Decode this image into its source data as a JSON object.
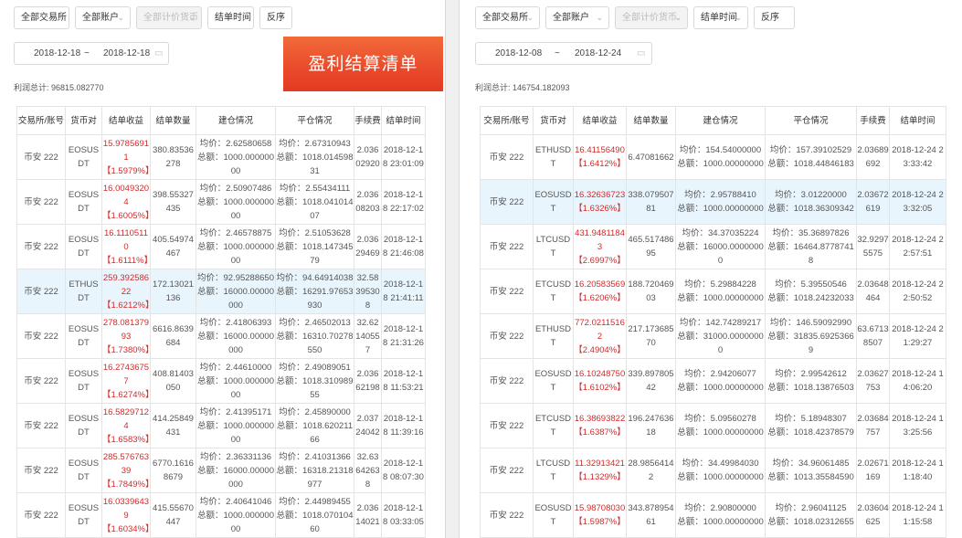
{
  "left": {
    "filters": [
      "全部交易所",
      "全部账户",
      "全部计价货币",
      "结单时间",
      "反序"
    ],
    "date_start": "2018-12-18",
    "date_sep": "~",
    "date_end": "2018-12-18",
    "total": "利润总计: 96815.082770",
    "headers": [
      "交易所/账号",
      "货币对",
      "结单收益",
      "结单数量",
      "建仓情况",
      "平仓情况",
      "手续费",
      "结单时间"
    ],
    "rows": [
      {
        "exchange": "币安 222",
        "pair": "EOSUSDT",
        "profit": "15.97856911",
        "pct": "【1.5979%】",
        "qty": "380.83536278",
        "open_price": "均价：2.62580658",
        "open_total": "总额：1000.00000000",
        "close_price": "均价：2.67310943",
        "close_total": "总额：1018.01459831",
        "fee": "2.03602920",
        "time": "2018-12-18 23:01:09",
        "highlight": false
      },
      {
        "exchange": "币安 222",
        "pair": "EOSUSDT",
        "profit": "16.00493204",
        "pct": "【1.6005%】",
        "qty": "398.55327435",
        "open_price": "均价：2.50907486",
        "open_total": "总额：1000.00000000",
        "close_price": "均价：2.55434111",
        "close_total": "总额：1018.04101407",
        "fee": "2.03608203",
        "time": "2018-12-18 22:17:02",
        "highlight": false
      },
      {
        "exchange": "币安 222",
        "pair": "EOSUSDT",
        "profit": "16.11105110",
        "pct": "【1.6111%】",
        "qty": "405.54974467",
        "open_price": "均价：2.46578875",
        "open_total": "总额：1000.00000000",
        "close_price": "均价：2.51053628",
        "close_total": "总额：1018.14734579",
        "fee": "2.03629469",
        "time": "2018-12-18 21:46:08",
        "highlight": false
      },
      {
        "exchange": "币安 222",
        "pair": "ETHUSDT",
        "profit": "259.39258622",
        "pct": "【1.6212%】",
        "qty": "172.13021136",
        "open_price": "均价：92.95288650",
        "open_total": "总额：16000.00000000",
        "close_price": "均价：94.64914038",
        "close_total": "总额：16291.97653930",
        "fee": "32.58395308",
        "time": "2018-12-18 21:41:11",
        "highlight": true
      },
      {
        "exchange": "币安 222",
        "pair": "EOSUSDT",
        "profit": "278.08137993",
        "pct": "【1.7380%】",
        "qty": "6616.8639684",
        "open_price": "均价：2.41806393",
        "open_total": "总额：16000.00000000",
        "close_price": "均价：2.46502013",
        "close_total": "总额：16310.70278550",
        "fee": "32.62140557",
        "time": "2018-12-18 21:31:26",
        "highlight": false
      },
      {
        "exchange": "币安 222",
        "pair": "EOSUSDT",
        "profit": "16.27436757",
        "pct": "【1.6274%】",
        "qty": "408.81403050",
        "open_price": "均价：2.44610000",
        "open_total": "总额：1000.00000000",
        "close_price": "均价：2.49089051",
        "close_total": "总额：1018.31098955",
        "fee": "2.03662198",
        "time": "2018-12-18 11:53:21",
        "highlight": false
      },
      {
        "exchange": "币安 222",
        "pair": "EOSUSDT",
        "profit": "16.58297124",
        "pct": "【1.6583%】",
        "qty": "414.25849431",
        "open_price": "均价：2.41395171",
        "open_total": "总额：1000.00000000",
        "close_price": "均价：2.45890000",
        "close_total": "总额：1018.62021166",
        "fee": "2.03724042",
        "time": "2018-12-18 11:39:16",
        "highlight": false
      },
      {
        "exchange": "币安 222",
        "pair": "EOSUSDT",
        "profit": "285.57676339",
        "pct": "【1.7849%】",
        "qty": "6770.16168679",
        "open_price": "均价：2.36331136",
        "open_total": "总额：16000.00000000",
        "close_price": "均价：2.41031366",
        "close_total": "总额：16318.21318977",
        "fee": "32.63642638",
        "time": "2018-12-18 08:07:30",
        "highlight": false
      },
      {
        "exchange": "币安 222",
        "pair": "EOSUSDT",
        "profit": "16.03396439",
        "pct": "【1.6034%】",
        "qty": "415.55670447",
        "open_price": "均价：2.40641046",
        "open_total": "总额：1000.00000000",
        "close_price": "均价：2.44989455",
        "close_total": "总额：1018.07010460",
        "fee": "2.03614021",
        "time": "2018-12-18 03:33:05",
        "highlight": false
      }
    ]
  },
  "right": {
    "filters": [
      "全部交易所",
      "全部账户",
      "全部计价货币",
      "结单时间",
      "反序"
    ],
    "date_start": "2018-12-08",
    "date_sep": "~",
    "date_end": "2018-12-24",
    "total": "利润总计: 146754.182093",
    "headers": [
      "交易所/账号",
      "货币对",
      "结单收益",
      "结单数量",
      "建仓情况",
      "平仓情况",
      "手续费",
      "结单时间"
    ],
    "rows": [
      {
        "exchange": "币安 222",
        "pair": "ETHUSDT",
        "profit": "16.41156490",
        "pct": "【1.6412%】",
        "qty": "6.47081662",
        "open_price": "均价：154.54000000",
        "open_total": "总额：1000.00000000",
        "close_price": "均价：157.39102529",
        "close_total": "总额：1018.44846183",
        "fee": "2.03689692",
        "time": "2018-12-24 23:33:42",
        "highlight": false
      },
      {
        "exchange": "币安 222",
        "pair": "EOSUSDT",
        "profit": "16.32636723",
        "pct": "【1.6326%】",
        "qty": "338.07950781",
        "open_price": "均价：2.95788410",
        "open_total": "总额：1000.00000000",
        "close_price": "均价：3.01220000",
        "close_total": "总额：1018.36309342",
        "fee": "2.03672619",
        "time": "2018-12-24 23:32:05",
        "highlight": true
      },
      {
        "exchange": "币安 222",
        "pair": "LTCUSDT",
        "profit": "431.94811843",
        "pct": "【2.6997%】",
        "qty": "465.51748695",
        "open_price": "均价：34.37035224",
        "open_total": "总额：16000.00000000",
        "close_price": "均价：35.36897826",
        "close_total": "总额：16464.87787418",
        "fee": "32.92975575",
        "time": "2018-12-24 22:57:51",
        "highlight": false
      },
      {
        "exchange": "币安 222",
        "pair": "ETCUSDT",
        "profit": "16.20583569",
        "pct": "【1.6206%】",
        "qty": "188.72046903",
        "open_price": "均价：5.29884228",
        "open_total": "总额：1000.00000000",
        "close_price": "均价：5.39550546",
        "close_total": "总额：1018.24232033",
        "fee": "2.03648464",
        "time": "2018-12-24 22:50:52",
        "highlight": false
      },
      {
        "exchange": "币安 222",
        "pair": "ETHUSDT",
        "profit": "772.02115162",
        "pct": "【2.4904%】",
        "qty": "217.17368570",
        "open_price": "均价：142.74289217",
        "open_total": "总额：31000.00000000",
        "close_price": "均价：146.59092990",
        "close_total": "总额：31835.69253669",
        "fee": "63.67138507",
        "time": "2018-12-24 21:29:27",
        "highlight": false
      },
      {
        "exchange": "币安 222",
        "pair": "EOSUSDT",
        "profit": "16.10248750",
        "pct": "【1.6102%】",
        "qty": "339.89780542",
        "open_price": "均价：2.94206077",
        "open_total": "总额：1000.00000000",
        "close_price": "均价：2.99542612",
        "close_total": "总额：1018.13876503",
        "fee": "2.03627753",
        "time": "2018-12-24 14:06:20",
        "highlight": false
      },
      {
        "exchange": "币安 222",
        "pair": "ETCUSDT",
        "profit": "16.38693822",
        "pct": "【1.6387%】",
        "qty": "196.24763618",
        "open_price": "均价：5.09560278",
        "open_total": "总额：1000.00000000",
        "close_price": "均价：5.18948307",
        "close_total": "总额：1018.42378579",
        "fee": "2.03684757",
        "time": "2018-12-24 13:25:56",
        "highlight": false
      },
      {
        "exchange": "币安 222",
        "pair": "LTCUSDT",
        "profit": "11.32913421",
        "pct": "【1.1329%】",
        "qty": "28.98564142",
        "open_price": "均价：34.49984030",
        "open_total": "总额：1000.00000000",
        "close_price": "均价：34.96061485",
        "close_total": "总额：1013.35584590",
        "fee": "2.02671169",
        "time": "2018-12-24 11:18:40",
        "highlight": false
      },
      {
        "exchange": "币安 222",
        "pair": "EOSUSDT",
        "profit": "15.98708030",
        "pct": "【1.5987%】",
        "qty": "343.87895461",
        "open_price": "均价：2.90800000",
        "open_total": "总额：1000.00000000",
        "close_price": "均价：2.96041125",
        "close_total": "总额：1018.02312655",
        "fee": "2.03604625",
        "time": "2018-12-24 11:15:58",
        "highlight": false
      }
    ]
  },
  "banner": "盈利结算清单",
  "icons": {
    "caret": "chevron-down-icon",
    "calendar": "calendar-icon"
  }
}
